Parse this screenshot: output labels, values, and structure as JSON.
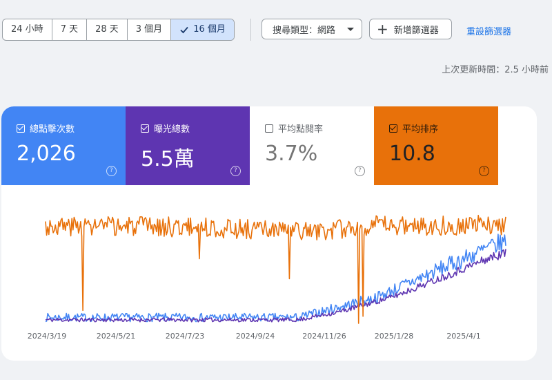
{
  "toolbar": {
    "date_ranges": [
      "24 小時",
      "7 天",
      "28 天",
      "3 個月",
      "16 個月"
    ],
    "selected_range": "16 個月",
    "search_type": "搜尋類型：網路",
    "add_filter": "新增篩選器",
    "reset_filters": "重設篩選器"
  },
  "last_updated": "上次更新時間：2.5 小時前",
  "metrics": {
    "clicks": {
      "label": "總點擊次數",
      "value": "2,026",
      "checked": true,
      "color": "#4285f4"
    },
    "impressions": {
      "label": "曝光總數",
      "value": "5.5萬",
      "checked": true,
      "color": "#5e35b1"
    },
    "ctr": {
      "label": "平均點閱率",
      "value": "3.7%",
      "checked": false,
      "color": "#ffffff"
    },
    "position": {
      "label": "平均排序",
      "value": "10.8",
      "checked": true,
      "color": "#e8710a"
    }
  },
  "chart_data": {
    "type": "line",
    "x_tick_labels": [
      "2024/3/19",
      "2024/5/21",
      "2024/7/23",
      "2024/9/24",
      "2024/11/26",
      "2025/1/28",
      "2025/4/1"
    ],
    "x_range": [
      "2024-03-13",
      "2025-05-05"
    ],
    "series": [
      {
        "name": "總點擊次數",
        "color": "#4285f4",
        "anchors": [
          [
            0,
            0.05
          ],
          [
            0.55,
            0.05
          ],
          [
            0.62,
            0.12
          ],
          [
            0.72,
            0.22
          ],
          [
            0.85,
            0.45
          ],
          [
            0.95,
            0.62
          ],
          [
            1.0,
            0.7
          ]
        ],
        "noise": 0.08,
        "seed": 7
      },
      {
        "name": "曝光總數",
        "color": "#5e35b1",
        "anchors": [
          [
            0,
            0.03
          ],
          [
            0.55,
            0.03
          ],
          [
            0.64,
            0.1
          ],
          [
            0.75,
            0.22
          ],
          [
            0.88,
            0.42
          ],
          [
            0.96,
            0.55
          ],
          [
            1.0,
            0.6
          ]
        ],
        "noise": 0.04,
        "seed": 11
      },
      {
        "name": "平均排序",
        "color": "#e8710a",
        "anchors": [
          [
            0,
            0.83
          ],
          [
            0.3,
            0.82
          ],
          [
            0.6,
            0.78
          ],
          [
            0.7,
            0.83
          ],
          [
            1.0,
            0.84
          ]
        ],
        "noise": 0.07,
        "seed": 3,
        "dips": [
          [
            0.082,
            0.11
          ],
          [
            0.335,
            0.55
          ],
          [
            0.53,
            0.38
          ],
          [
            0.68,
            0.0
          ],
          [
            0.69,
            0.06
          ]
        ]
      }
    ],
    "grid": false
  }
}
